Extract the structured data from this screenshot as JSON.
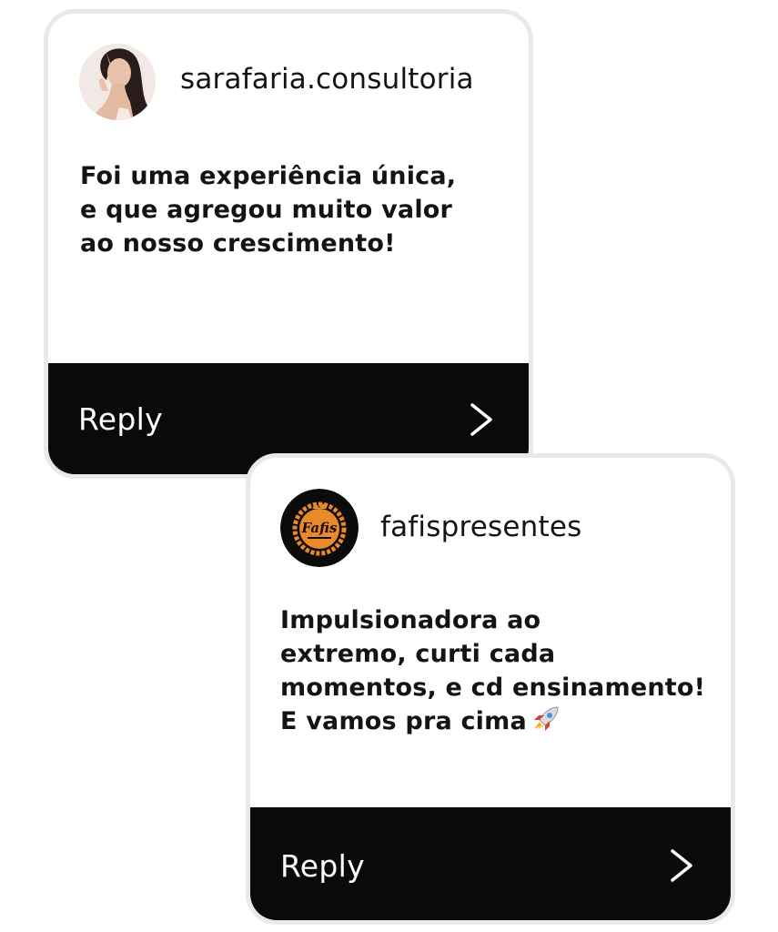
{
  "comments": [
    {
      "username": "sarafaria.consultoria",
      "message": "Foi uma experiência única,\ne que agregou muito valor\nao nosso crescimento!",
      "reply_label": "Reply",
      "avatar_icon": "profile-photo-woman"
    },
    {
      "username": "fafispresentes",
      "message": "Impulsionadora ao\nextremo, curti cada\nmomentos, e cd ensinamento!\nE vamos pra cima",
      "emoji": "rocket-icon",
      "reply_label": "Reply",
      "avatar_logo_text": "Fafis",
      "avatar_icon": "fafis-logo"
    }
  ],
  "colors": {
    "bar": "#0a0a0a",
    "card_border": "#e9e9e9",
    "logo_orange": "#e8892b"
  }
}
